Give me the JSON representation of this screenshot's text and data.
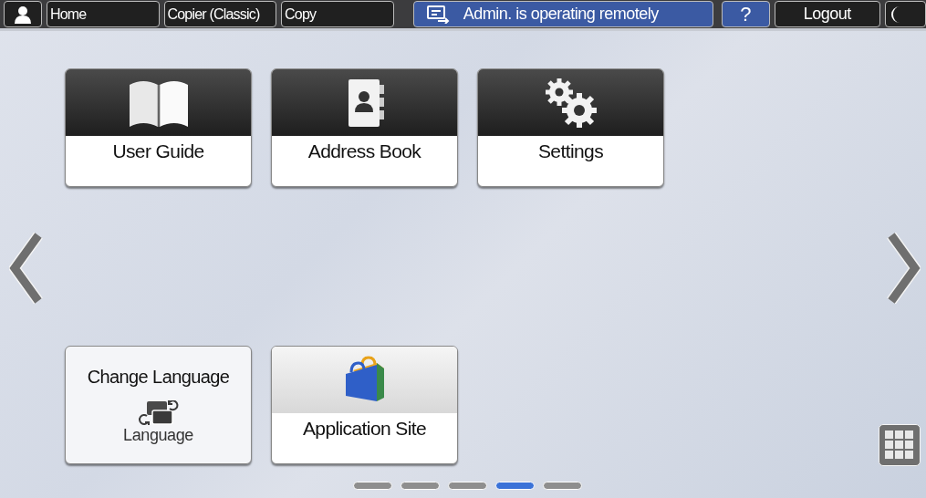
{
  "top_bar": {
    "home": "Home",
    "breadcrumbs": [
      "Copier (Classic)",
      "Copy"
    ],
    "remote_status": "Admin. is operating remotely",
    "help": "?",
    "logout": "Logout"
  },
  "tiles": [
    {
      "kind": "guide",
      "label": "User Guide"
    },
    {
      "kind": "contacts",
      "label": "Address Book"
    },
    {
      "kind": "settings",
      "label": "Settings"
    },
    {
      "kind": "language",
      "label": "Change Language",
      "sublabel": "Language"
    },
    {
      "kind": "store",
      "label": "Application Site"
    }
  ],
  "pages": [
    {
      "selected": false
    },
    {
      "selected": false
    },
    {
      "selected": false
    },
    {
      "selected": true
    },
    {
      "selected": false
    }
  ]
}
